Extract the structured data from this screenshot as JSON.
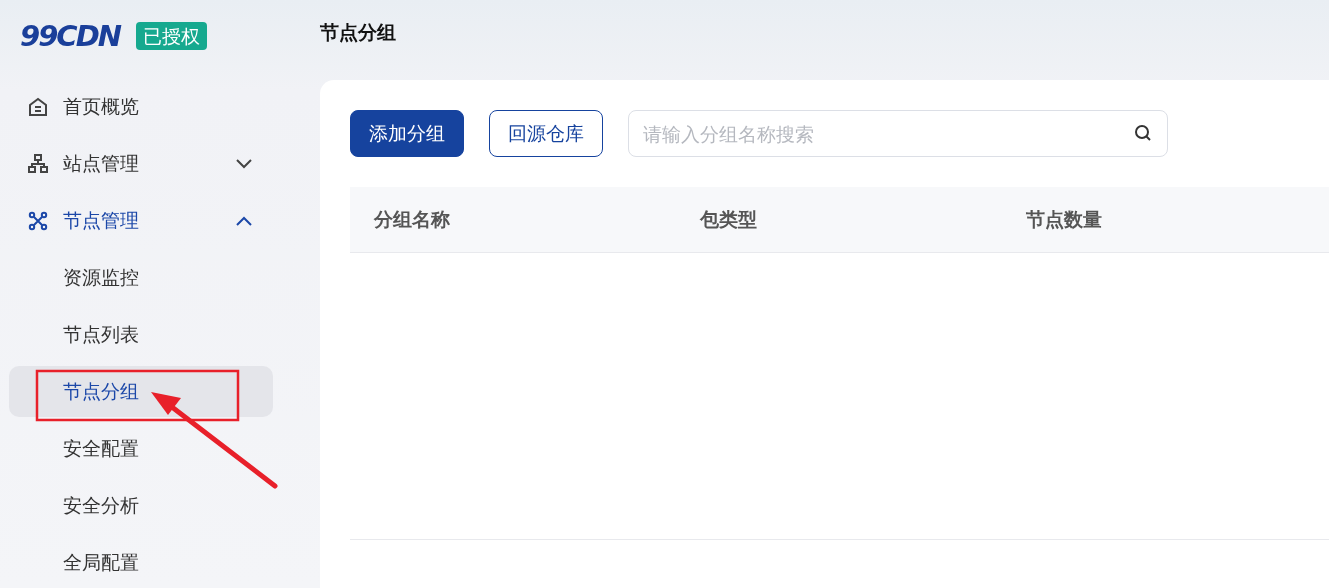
{
  "logo": {
    "text": "99CDN",
    "badge": "已授权"
  },
  "sidebar": {
    "items": [
      {
        "label": "首页概览",
        "selected": false
      },
      {
        "label": "站点管理",
        "selected": false,
        "expanded": false
      },
      {
        "label": "节点管理",
        "selected": true,
        "expanded": true,
        "children": [
          {
            "label": "资源监控",
            "selected": false
          },
          {
            "label": "节点列表",
            "selected": false
          },
          {
            "label": "节点分组",
            "selected": true
          },
          {
            "label": "安全配置",
            "selected": false
          },
          {
            "label": "安全分析",
            "selected": false
          },
          {
            "label": "全局配置",
            "selected": false
          }
        ]
      }
    ]
  },
  "page_title": "节点分组",
  "toolbar": {
    "buttons": [
      {
        "label": "添加分组",
        "kind": "primary"
      },
      {
        "label": "回源仓库",
        "kind": "outline"
      }
    ],
    "search": {
      "placeholder": "请输入分组名称搜索"
    }
  },
  "table": {
    "columns": [
      "分组名称",
      "包类型",
      "节点数量"
    ]
  }
}
